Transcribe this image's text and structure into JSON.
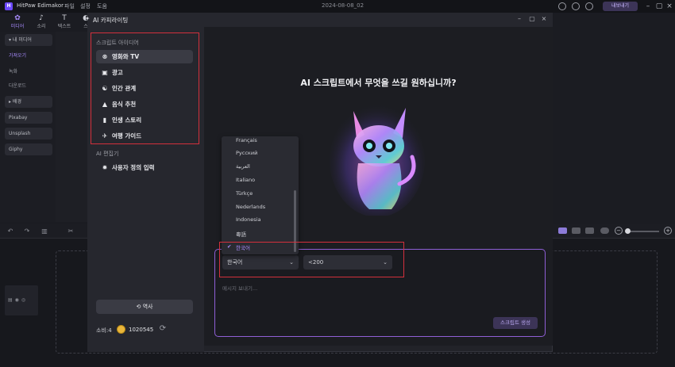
{
  "titlebar": {
    "app_name": "HitPaw Edimakor",
    "menus": [
      "파일",
      "설정",
      "도움"
    ],
    "doc_title": "2024-08-08_02",
    "export_label": "내보내기"
  },
  "toolbar": {
    "tools": [
      {
        "label": "미디어",
        "icon": "media-icon"
      },
      {
        "label": "소리",
        "icon": "audio-icon"
      },
      {
        "label": "텍스트",
        "icon": "text-icon"
      },
      {
        "label": "스",
        "icon": "sticker-icon"
      }
    ]
  },
  "sidebar": {
    "items": [
      {
        "label": "▾ 내 미디어",
        "kind": "head"
      },
      {
        "label": "가져오기",
        "kind": "sel"
      },
      {
        "label": "녹화",
        "kind": "sub"
      },
      {
        "label": "다운로드",
        "kind": "sub"
      },
      {
        "label": "▸ 배경",
        "kind": "head"
      },
      {
        "label": "Pixabay",
        "kind": "head"
      },
      {
        "label": "Unsplash",
        "kind": "head"
      },
      {
        "label": "Giphy",
        "kind": "head"
      }
    ]
  },
  "dialog": {
    "title": "AI 카피라이팅",
    "ideas_label": "스크립트 아이디어",
    "ideas": [
      {
        "label": "영화와 TV",
        "icon": "film-icon"
      },
      {
        "label": "광고",
        "icon": "chart-icon"
      },
      {
        "label": "인간 관계",
        "icon": "people-icon"
      },
      {
        "label": "음식 추천",
        "icon": "food-icon"
      },
      {
        "label": "인생 스토리",
        "icon": "book-icon"
      },
      {
        "label": "여행 가이드",
        "icon": "plane-icon"
      }
    ],
    "ai_editor_label": "AI 편집기",
    "custom_input_label": "사용자 정의 입력",
    "history_label": "역사",
    "credits_label": "소비:4",
    "credits_value": "1020545",
    "headline": "AI 스크립트에서 무엇을 쓰길 원하십니까?",
    "language": {
      "selected": "한국어",
      "options": [
        "Français",
        "Русский",
        "العربية",
        "Italiano",
        "Türkçe",
        "Nederlands",
        "Indonesia",
        "粵語",
        "한국어"
      ]
    },
    "length": {
      "selected": "<200"
    },
    "message_placeholder": "메시지 보내기...",
    "generate_label": "스크립트 생성"
  },
  "colors": {
    "accent": "#a98cff",
    "highlight_box": "#d3303c",
    "prompt_border": "#8f5fd6"
  }
}
